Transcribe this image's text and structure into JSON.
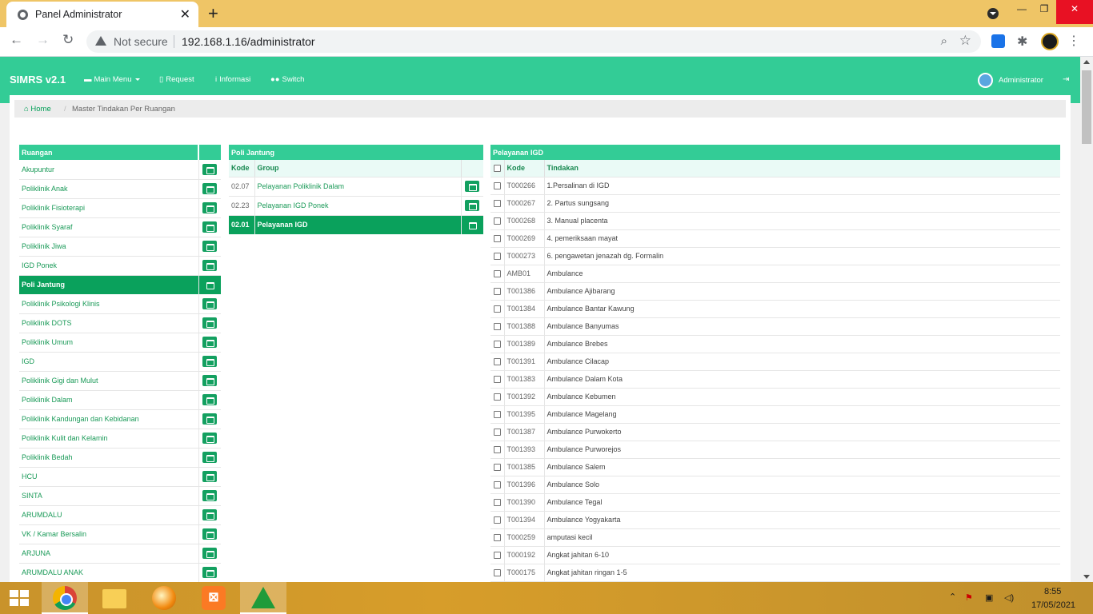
{
  "browser": {
    "tab_title": "Panel Administrator",
    "tab_close": "✕",
    "new_tab": "+",
    "security_label": "Not secure",
    "url": "192.168.1.16/administrator",
    "window_controls": [
      "—",
      "❐",
      "✕"
    ]
  },
  "navbar": {
    "brand": "SIMRS v2.1",
    "items": [
      {
        "label": "Main Menu",
        "icon": "folder-icon"
      },
      {
        "label": "Request",
        "icon": "file-icon"
      },
      {
        "label": "Informasi",
        "icon": "info-icon"
      },
      {
        "label": "Switch",
        "icon": "users-icon"
      }
    ],
    "user": "Administrator"
  },
  "breadcrumb": {
    "home": "Home",
    "separator": "/",
    "current": "Master Tindakan Per Ruangan"
  },
  "ruangan": {
    "header": "Ruangan",
    "selected_index": 6,
    "items": [
      "Akupuntur",
      "Poliklinik Anak",
      "Poliklinik Fisioterapi",
      "Poliklinik Syaraf",
      "Poliklinik Jiwa",
      "IGD Ponek",
      "Poli Jantung",
      "Poliklinik Psikologi Klinis",
      "Poliklinik DOTS",
      "Poliklinik Umum",
      "IGD",
      "Poliklinik Gigi dan Mulut",
      "Poliklinik Dalam",
      "Poliklinik Kandungan dan Kebidanan",
      "Poliklinik Kulit dan Kelamin",
      "Poliklinik Bedah",
      "HCU",
      "SINTA",
      "ARUMDALU",
      "VK / Kamar Bersalin",
      "ARJUNA",
      "ARUMDALU ANAK"
    ]
  },
  "poli": {
    "header": "Poli Jantung",
    "col_kode": "Kode",
    "col_group": "Group",
    "selected_index": 2,
    "rows": [
      {
        "kode": "02.07",
        "group": "Pelayanan Poliklinik Dalam"
      },
      {
        "kode": "02.23",
        "group": "Pelayanan IGD Ponek"
      },
      {
        "kode": "02.01",
        "group": "Pelayanan IGD"
      }
    ]
  },
  "pelayanan": {
    "header": "Pelayanan IGD",
    "col_kode": "Kode",
    "col_tindakan": "Tindakan",
    "rows": [
      {
        "kode": "T000266",
        "tindakan": "1.Persalinan di IGD"
      },
      {
        "kode": "T000267",
        "tindakan": "2. Partus sungsang"
      },
      {
        "kode": "T000268",
        "tindakan": "3. Manual placenta"
      },
      {
        "kode": "T000269",
        "tindakan": "4. pemeriksaan mayat"
      },
      {
        "kode": "T000273",
        "tindakan": "6. pengawetan jenazah dg. Formalin"
      },
      {
        "kode": "AMB01",
        "tindakan": "Ambulance"
      },
      {
        "kode": "T001386",
        "tindakan": "Ambulance Ajibarang"
      },
      {
        "kode": "T001384",
        "tindakan": "Ambulance Bantar Kawung"
      },
      {
        "kode": "T001388",
        "tindakan": "Ambulance Banyumas"
      },
      {
        "kode": "T001389",
        "tindakan": "Ambulance Brebes"
      },
      {
        "kode": "T001391",
        "tindakan": "Ambulance Cilacap"
      },
      {
        "kode": "T001383",
        "tindakan": "Ambulance Dalam Kota"
      },
      {
        "kode": "T001392",
        "tindakan": "Ambulance Kebumen"
      },
      {
        "kode": "T001395",
        "tindakan": "Ambulance Magelang"
      },
      {
        "kode": "T001387",
        "tindakan": "Ambulance Purwokerto"
      },
      {
        "kode": "T001393",
        "tindakan": "Ambulance Purworejos"
      },
      {
        "kode": "T001385",
        "tindakan": "Ambulance Salem"
      },
      {
        "kode": "T001396",
        "tindakan": "Ambulance Solo"
      },
      {
        "kode": "T001390",
        "tindakan": "Ambulance Tegal"
      },
      {
        "kode": "T001394",
        "tindakan": "Ambulance Yogyakarta"
      },
      {
        "kode": "T000259",
        "tindakan": "amputasi kecil"
      },
      {
        "kode": "T000192",
        "tindakan": "Angkat jahitan 6-10"
      },
      {
        "kode": "T000175",
        "tindakan": "Angkat jahitan ringan 1-5"
      }
    ]
  },
  "taskbar": {
    "time": "8:55",
    "date": "17/05/2021"
  },
  "colors": {
    "navbar": "#33cc96",
    "selected": "#0aa15c",
    "tabbar": "#efc566"
  }
}
